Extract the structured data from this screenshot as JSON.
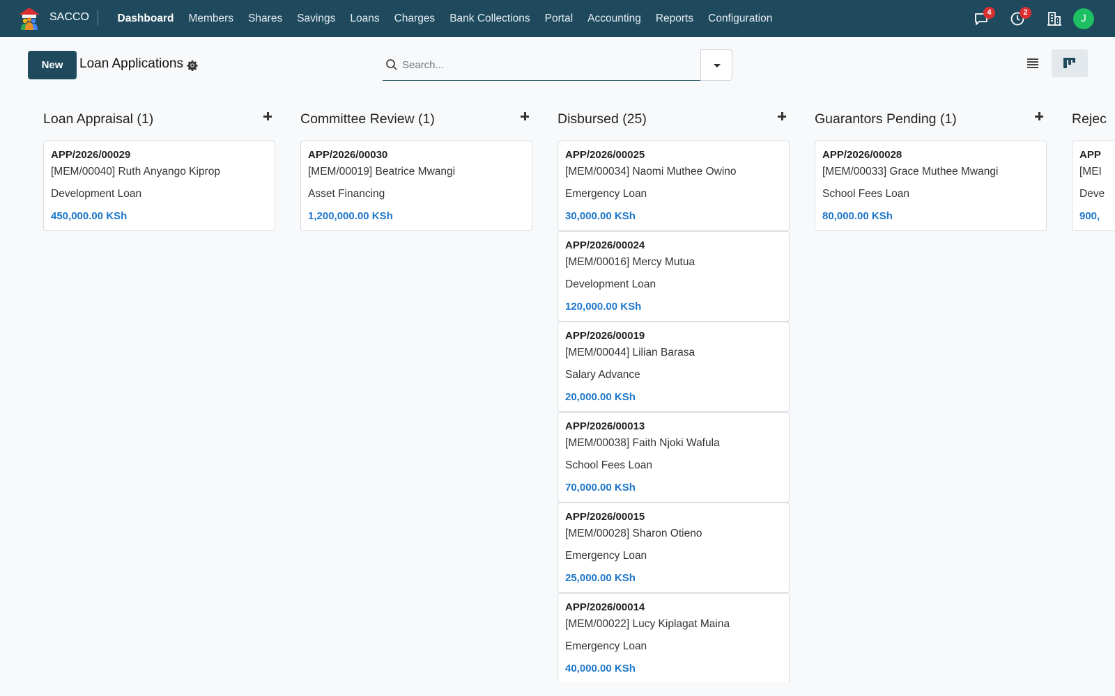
{
  "app": {
    "brand": "SACCO",
    "menu": [
      "Dashboard",
      "Members",
      "Shares",
      "Savings",
      "Loans",
      "Charges",
      "Bank Collections",
      "Portal",
      "Accounting",
      "Reports",
      "Configuration"
    ],
    "active_menu": "Dashboard",
    "messages_count": "4",
    "activities_count": "2",
    "user_initial": "J",
    "colors": {
      "navbar": "#1f4a5e",
      "accent_amount": "#1e77c9",
      "badge": "#d9302f",
      "avatar": "#1fbf63"
    }
  },
  "control": {
    "new_label": "New",
    "title": "Loan Applications",
    "search_placeholder": "Search..."
  },
  "columns": [
    {
      "title": "Loan Appraisal (1)",
      "cards": [
        {
          "ref": "APP/2026/00029",
          "member": "[MEM/00040] Ruth Anyango Kiprop",
          "product": "Development Loan",
          "amount": "450,000.00 KSh"
        }
      ]
    },
    {
      "title": "Committee Review (1)",
      "cards": [
        {
          "ref": "APP/2026/00030",
          "member": "[MEM/00019] Beatrice Mwangi",
          "product": "Asset Financing",
          "amount": "1,200,000.00 KSh"
        }
      ]
    },
    {
      "title": "Disbursed (25)",
      "cards": [
        {
          "ref": "APP/2026/00025",
          "member": "[MEM/00034] Naomi Muthee Owino",
          "product": "Emergency Loan",
          "amount": "30,000.00 KSh"
        },
        {
          "ref": "APP/2026/00024",
          "member": "[MEM/00016] Mercy Mutua",
          "product": "Development Loan",
          "amount": "120,000.00 KSh"
        },
        {
          "ref": "APP/2026/00019",
          "member": "[MEM/00044] Lilian Barasa",
          "product": "Salary Advance",
          "amount": "20,000.00 KSh"
        },
        {
          "ref": "APP/2026/00013",
          "member": "[MEM/00038] Faith Njoki Wafula",
          "product": "School Fees Loan",
          "amount": "70,000.00 KSh"
        },
        {
          "ref": "APP/2026/00015",
          "member": "[MEM/00028] Sharon Otieno",
          "product": "Emergency Loan",
          "amount": "25,000.00 KSh"
        },
        {
          "ref": "APP/2026/00014",
          "member": "[MEM/00022] Lucy Kiplagat Maina",
          "product": "Emergency Loan",
          "amount": "40,000.00 KSh"
        }
      ]
    },
    {
      "title": "Guarantors Pending (1)",
      "cards": [
        {
          "ref": "APP/2026/00028",
          "member": "[MEM/00033] Grace Muthee Mwangi",
          "product": "School Fees Loan",
          "amount": "80,000.00 KSh"
        }
      ]
    },
    {
      "title": "Rejec",
      "cards": [
        {
          "ref": "APP",
          "member": "[MEI",
          "product": "Deve",
          "amount": "900,"
        }
      ]
    }
  ]
}
